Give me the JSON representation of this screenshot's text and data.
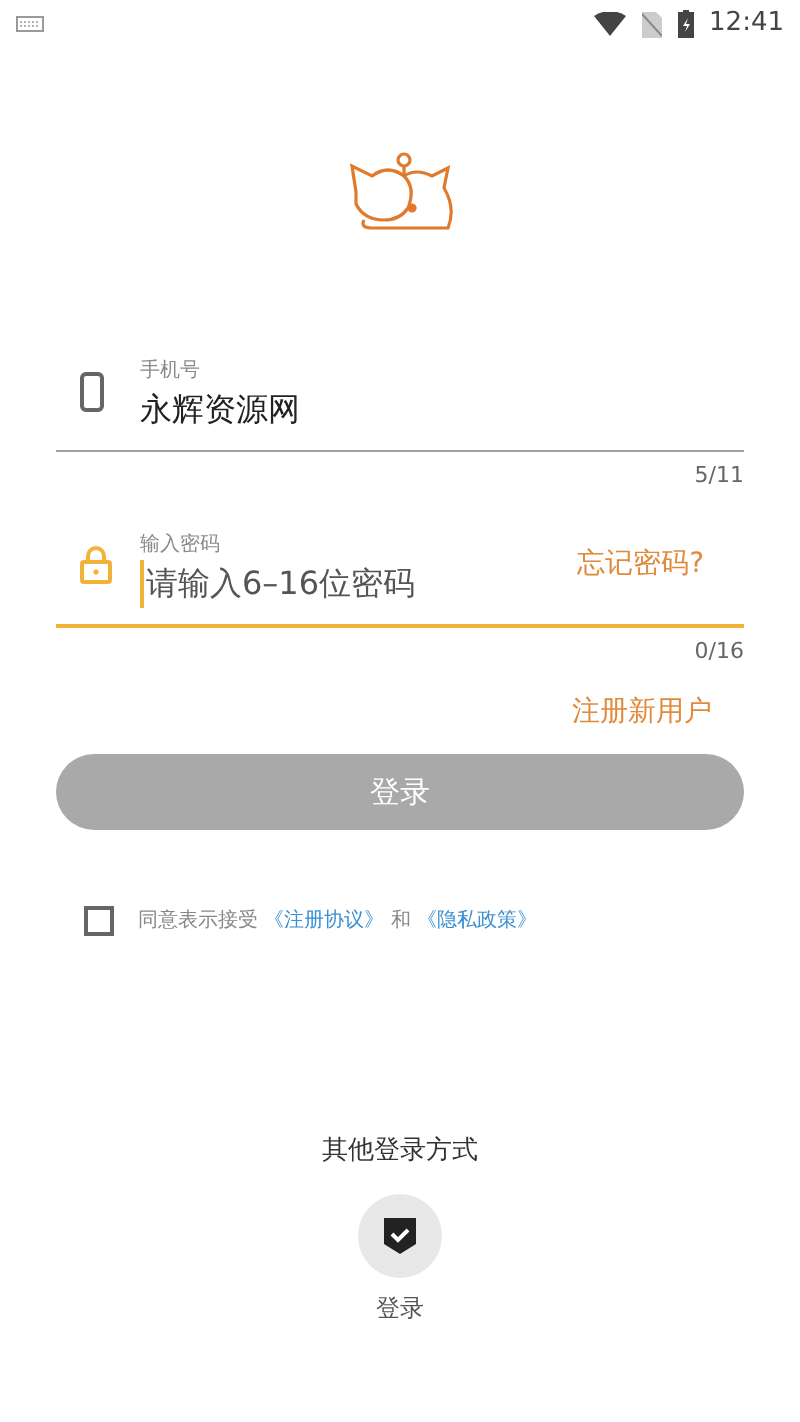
{
  "status_bar": {
    "time": "12:41"
  },
  "phone_field": {
    "label": "手机号",
    "value": "永辉资源网",
    "counter": "5/11",
    "focused": false
  },
  "password_field": {
    "label": "输入密码",
    "placeholder": "请输入6–16位密码",
    "counter": "0/16",
    "focused": true,
    "forgot": "忘记密码?"
  },
  "register_link": "注册新用户",
  "login_button": {
    "label": "登录",
    "disabled": true
  },
  "agreement": {
    "checked": false,
    "prefix": "同意表示接受",
    "terms": "《注册协议》",
    "and": "和",
    "privacy": "《隐私政策》"
  },
  "other_login": {
    "title": "其他登录方式",
    "caption": "登录"
  }
}
